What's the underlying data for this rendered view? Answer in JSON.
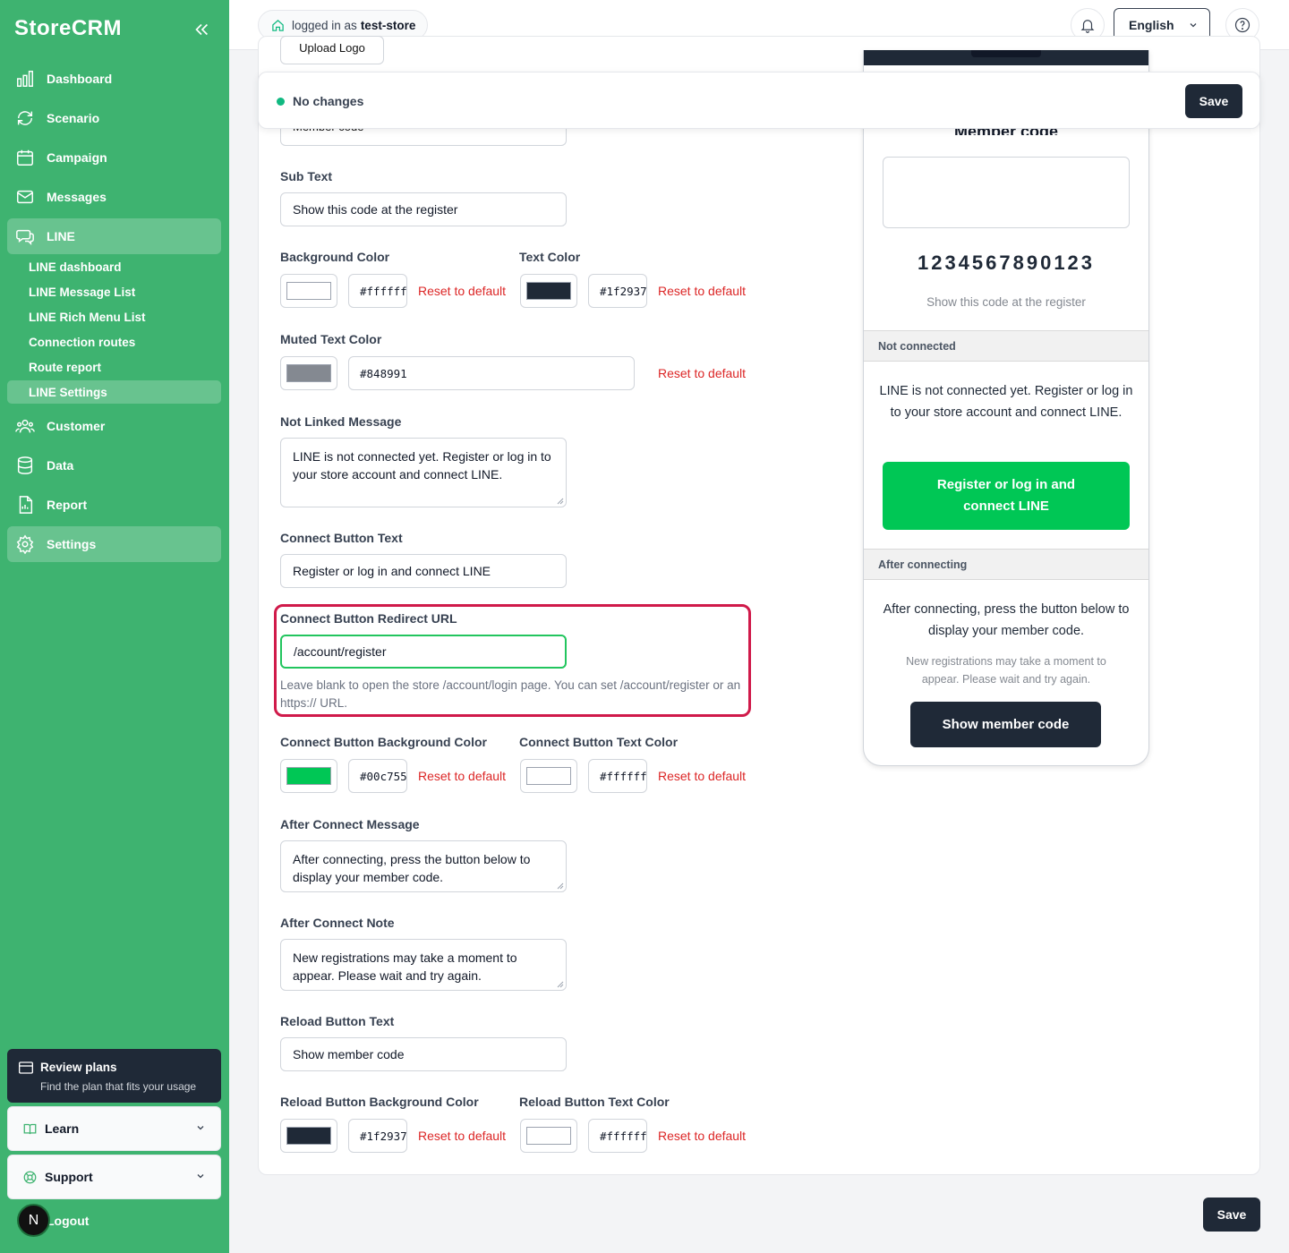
{
  "sidebar": {
    "brand": "StoreCRM",
    "items": [
      {
        "label": "Dashboard",
        "icon": "chart-bars-icon"
      },
      {
        "label": "Scenario",
        "icon": "refresh-icon"
      },
      {
        "label": "Campaign",
        "icon": "calendar-icon"
      },
      {
        "label": "Messages",
        "icon": "mail-icon"
      },
      {
        "label": "LINE",
        "icon": "chat-icon"
      },
      {
        "label": "Customer",
        "icon": "users-icon"
      },
      {
        "label": "Data",
        "icon": "database-icon"
      },
      {
        "label": "Report",
        "icon": "report-icon"
      },
      {
        "label": "Settings",
        "icon": "gear-icon"
      }
    ],
    "line_sub": [
      "LINE dashboard",
      "LINE Message List",
      "LINE Rich Menu List",
      "Connection routes",
      "Route report",
      "LINE Settings"
    ],
    "review": {
      "title": "Review plans",
      "subtitle": "Find the plan that fits your usage"
    },
    "learn": "Learn",
    "support": "Support",
    "logout": "Logout",
    "avatar_letter": "N"
  },
  "header": {
    "logged_in_prefix": "logged in as",
    "store": "test-store",
    "language": "English"
  },
  "sticky": {
    "status": "No changes",
    "save": "Save"
  },
  "form": {
    "upload_logo": "Upload Logo",
    "member_code_value": "Member code",
    "sub_text": {
      "label": "Sub Text",
      "value": "Show this code at the register"
    },
    "bg_color": {
      "label": "Background Color",
      "hex": "#ffffff",
      "swatch": "#ffffff"
    },
    "text_color": {
      "label": "Text Color",
      "hex": "#1f2937",
      "swatch": "#1f2937"
    },
    "muted_color": {
      "label": "Muted Text Color",
      "hex": "#848991",
      "swatch": "#848991"
    },
    "not_linked": {
      "label": "Not Linked Message",
      "value": "LINE is not connected yet. Register or log in to your store account and connect LINE."
    },
    "connect_text": {
      "label": "Connect Button Text",
      "value": "Register or log in and connect LINE"
    },
    "redirect_url": {
      "label": "Connect Button Redirect URL",
      "value": "/account/register",
      "hint": "Leave blank to open the store /account/login page. You can set /account/register or an https:// URL."
    },
    "connect_bg": {
      "label": "Connect Button Background Color",
      "hex": "#00c755",
      "swatch": "#00c755"
    },
    "connect_fg": {
      "label": "Connect Button Text Color",
      "hex": "#ffffff",
      "swatch": "#ffffff"
    },
    "after_msg": {
      "label": "After Connect Message",
      "value": "After connecting, press the button below to display your member code."
    },
    "after_note": {
      "label": "After Connect Note",
      "value": "New registrations may take a moment to appear. Please wait and try again."
    },
    "reload_text": {
      "label": "Reload Button Text",
      "value": "Show member code"
    },
    "reload_bg": {
      "label": "Reload Button Background Color",
      "hex": "#1f2937",
      "swatch": "#1f2937"
    },
    "reload_fg": {
      "label": "Reload Button Text Color",
      "hex": "#ffffff",
      "swatch": "#ffffff"
    },
    "reset": "Reset to default"
  },
  "preview": {
    "member_code_title": "Member code",
    "code": "1234567890123",
    "sub": "Show this code at the register",
    "not_connected_head": "Not connected",
    "not_connected_msg": "LINE is not connected yet. Register or log in to your store account and connect LINE.",
    "connect_btn": "Register or log in and connect LINE",
    "after_head": "After connecting",
    "after_msg": "After connecting, press the button below to display your member code.",
    "after_note": "New registrations may take a moment to appear. Please wait and try again.",
    "reload_btn": "Show member code"
  },
  "bottom_save": "Save",
  "colors": {
    "sidebar": "#3eb370",
    "accent_green": "#00c755",
    "dark": "#1f2937",
    "danger": "#dc2626",
    "highlight": "#d01a4a"
  }
}
